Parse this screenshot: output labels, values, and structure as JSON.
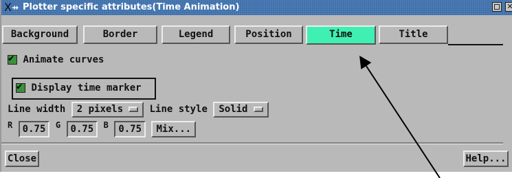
{
  "window": {
    "title": "Plotter specific attributes(Time Animation)",
    "close_glyph": "✕"
  },
  "tabs": [
    {
      "label": "Background"
    },
    {
      "label": "Border"
    },
    {
      "label": "Legend"
    },
    {
      "label": "Position"
    },
    {
      "label": "Time",
      "active": true
    },
    {
      "label": "Title"
    }
  ],
  "time": {
    "animate_curves_label": "Animate curves",
    "animate_curves_checked": true,
    "display_marker_label": "Display time marker",
    "display_marker_checked": true,
    "line_width_label": "Line width",
    "line_width_value": "2 pixels",
    "line_style_label": "Line style",
    "line_style_value": "Solid",
    "r_label": "R",
    "r_value": "0.75",
    "g_label": "G",
    "g_value": "0.75",
    "b_label": "B",
    "b_value": "0.75",
    "mix_label": "Mix..."
  },
  "footer": {
    "close_label": "Close",
    "help_label": "Help..."
  },
  "colors": {
    "active_tab": "#3ff0b2",
    "window_bg": "#b9b9b9",
    "title_bar": "#3c6ea9"
  }
}
